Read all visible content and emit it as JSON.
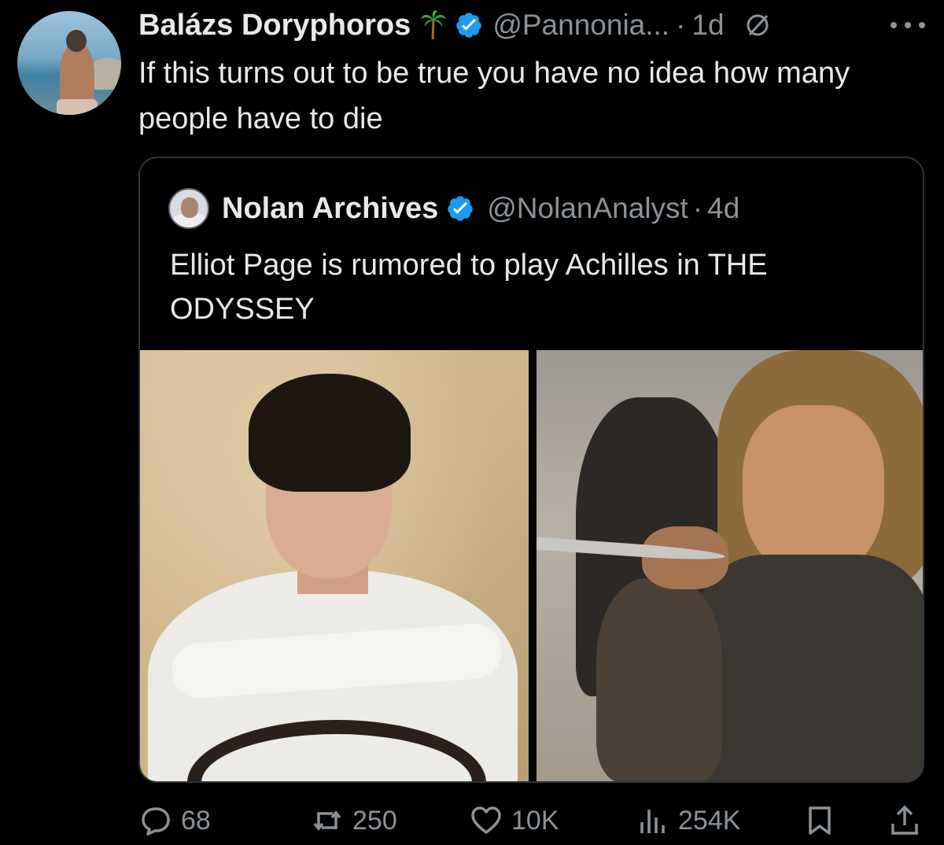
{
  "author": {
    "display_name": "Balázs Doryphoros",
    "name_emoji": "palm-tree",
    "handle": "@Pannonia...",
    "separator": "·",
    "time": "1d"
  },
  "tweet_text": "If this turns out to be true you have no idea how many people have to die",
  "quote": {
    "display_name": "Nolan Archives",
    "handle": "@NolanAnalyst",
    "separator": "·",
    "time": "4d",
    "text": "Elliot Page is rumored to play Achilles in THE ODYSSEY"
  },
  "metrics": {
    "replies": "68",
    "reposts": "250",
    "likes": "10K",
    "views": "254K"
  },
  "colors": {
    "background": "#000000",
    "text": "#e7e9ea",
    "secondary": "#8b9298",
    "verified": "#1d9bf0",
    "border": "#2f3336"
  }
}
